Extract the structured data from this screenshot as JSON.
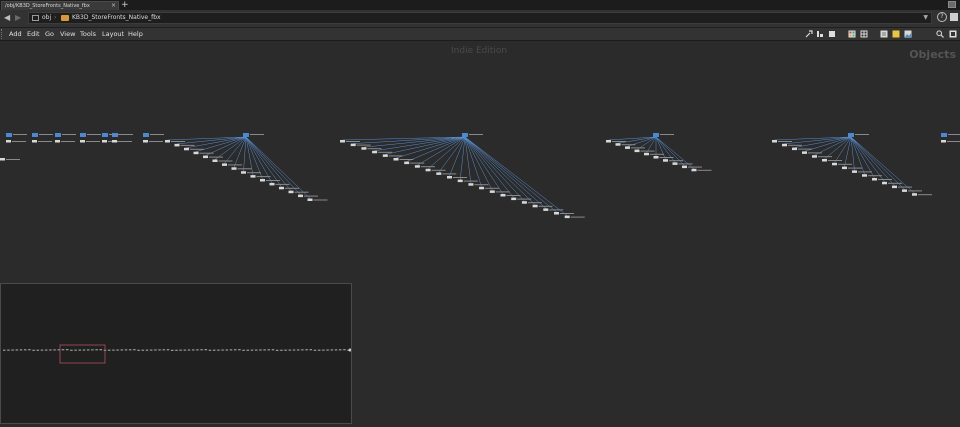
{
  "tab": {
    "label": "/obj/KB3D_StoreFronts_Native_fbx",
    "close": "×",
    "add": "+"
  },
  "path": {
    "root": "obj",
    "separator": "›",
    "node": "KB3D_StoreFronts_Native_fbx",
    "help": "?"
  },
  "menu": {
    "items": [
      "Add",
      "Edit",
      "Go",
      "View",
      "Tools",
      "Layout",
      "Help"
    ]
  },
  "toolbar": {
    "icons": [
      "wrench-icon",
      "layout-icon",
      "square-icon",
      "palette-icon",
      "grid-icon",
      "notes-icon",
      "sticky-icon",
      "image-icon",
      "search-icon",
      "fullscreen-icon"
    ]
  },
  "canvas": {
    "watermark": "Indie Edition",
    "context_label": "Objects"
  },
  "colors": {
    "wire": "#5a8fd0",
    "node_body": "#d8d8d8",
    "node_icon": "#4a8ad4",
    "minimap_frame": "#b05060"
  },
  "network": {
    "hubs": [
      {
        "id": "h1",
        "children": 16
      },
      {
        "id": "h2",
        "children": 22
      },
      {
        "id": "h3",
        "children": 10
      },
      {
        "id": "h4",
        "children": 15
      }
    ]
  }
}
